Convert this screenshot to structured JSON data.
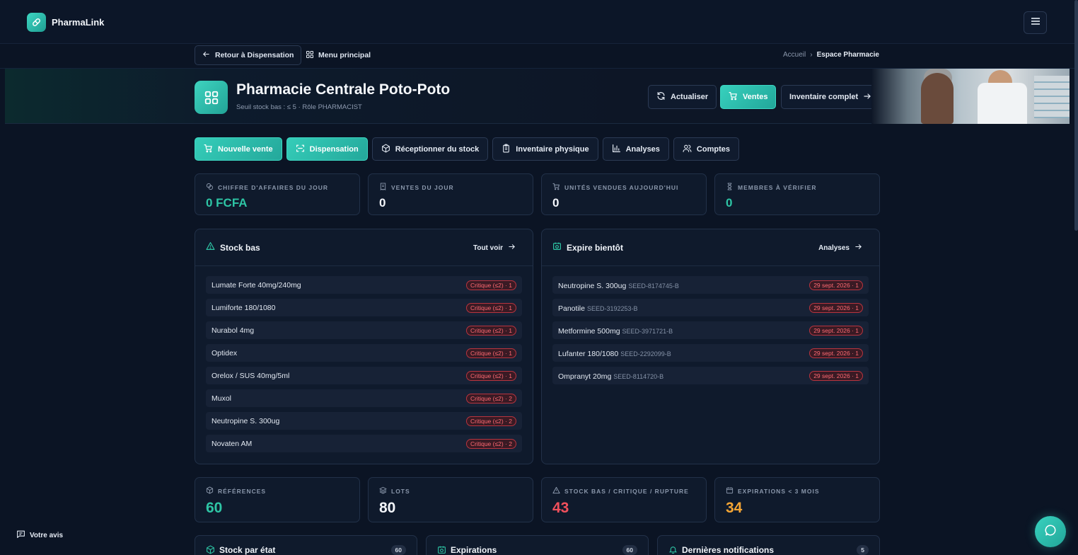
{
  "app": {
    "name": "PharmaLink"
  },
  "subnav": {
    "back_label": "Retour à Dispensation",
    "main_menu_label": "Menu principal",
    "breadcrumb": {
      "home": "Accueil",
      "separator": "›",
      "current": "Espace Pharmacie"
    }
  },
  "hero": {
    "title": "Pharmacie Centrale Poto-Poto",
    "subtitle": "Seuil stock bas : ≤ 5 · Rôle PHARMACIST",
    "refresh_label": "Actualiser",
    "sales_label": "Ventes",
    "inventory_label": "Inventaire complet"
  },
  "actions": [
    {
      "label": "Nouvelle vente"
    },
    {
      "label": "Dispensation"
    },
    {
      "label": "Réceptionner du stock"
    },
    {
      "label": "Inventaire physique"
    },
    {
      "label": "Analyses"
    },
    {
      "label": "Comptes"
    }
  ],
  "kpis_top": [
    {
      "label": "CHIFFRE D'AFFAIRES DU JOUR",
      "value": "0 FCFA",
      "color": "#2ec5a5"
    },
    {
      "label": "VENTES DU JOUR",
      "value": "0",
      "color": "#f3f6fb"
    },
    {
      "label": "UNITÉS VENDUES AUJOURD'HUI",
      "value": "0",
      "color": "#f3f6fb"
    },
    {
      "label": "MEMBRES À VÉRIFIER",
      "value": "0",
      "color": "#2ec5a5"
    }
  ],
  "low_stock": {
    "title": "Stock bas",
    "link": "Tout voir",
    "items": [
      {
        "name": "Lumate Forte 40mg/240mg",
        "badge": "Critique (≤2) · 1"
      },
      {
        "name": "Lumiforte 180/1080",
        "badge": "Critique (≤2) · 1"
      },
      {
        "name": "Nurabol 4mg",
        "badge": "Critique (≤2) · 1"
      },
      {
        "name": "Optidex",
        "badge": "Critique (≤2) · 1"
      },
      {
        "name": "Orelox / SUS 40mg/5ml",
        "badge": "Critique (≤2) · 1"
      },
      {
        "name": "Muxol",
        "badge": "Critique (≤2) · 2"
      },
      {
        "name": "Neutropine S. 300ug",
        "badge": "Critique (≤2) · 2"
      },
      {
        "name": "Novaten AM",
        "badge": "Critique (≤2) · 2"
      }
    ]
  },
  "expiring": {
    "title": "Expire bientôt",
    "link": "Analyses",
    "items": [
      {
        "name": "Neutropine S. 300ug",
        "code": "SEED-8174745-B",
        "badge": "29 sept. 2026 · 1"
      },
      {
        "name": "Panotile",
        "code": "SEED-3192253-B",
        "badge": "29 sept. 2026 · 1"
      },
      {
        "name": "Metformine 500mg",
        "code": "SEED-3971721-B",
        "badge": "29 sept. 2026 · 1"
      },
      {
        "name": "Lufanter 180/1080",
        "code": "SEED-2292099-B",
        "badge": "29 sept. 2026 · 1"
      },
      {
        "name": "Ompranyt 20mg",
        "code": "SEED-8114720-B",
        "badge": "29 sept. 2026 · 1"
      }
    ]
  },
  "kpis_bottom": [
    {
      "label": "RÉFÉRENCES",
      "value": "60",
      "color": "#2ec5a5"
    },
    {
      "label": "LOTS",
      "value": "80",
      "color": "#f3f6fb"
    },
    {
      "label": "STOCK BAS / CRITIQUE / RUPTURE",
      "value": "43",
      "color": "#f0505c"
    },
    {
      "label": "EXPIRATIONS < 3 MOIS",
      "value": "34",
      "color": "#f5a534"
    }
  ],
  "bottom_cards": [
    {
      "title": "Stock par état",
      "count": "60"
    },
    {
      "title": "Expirations",
      "count": "60"
    },
    {
      "title": "Dernières notifications",
      "count": "5"
    }
  ],
  "feedback_label": "Votre avis",
  "colors": {
    "accent": "#2ec5a5",
    "danger": "#f0505c",
    "warning": "#f5a534",
    "background": "#0b1424"
  }
}
